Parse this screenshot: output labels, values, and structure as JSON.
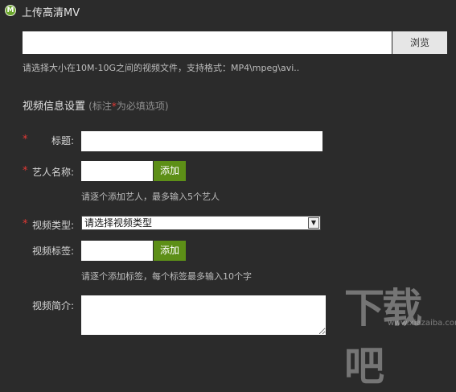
{
  "window": {
    "title": "上传高清MV",
    "logo_letter": "M"
  },
  "upload": {
    "browse_label": "浏览",
    "hint": "请选择大小在10M-10G之间的视频文件，支持格式：MP4\\mpeg\\avi.."
  },
  "section": {
    "title": "视频信息设置",
    "note_prefix": "(标注",
    "note_star": "*",
    "note_suffix": "为必填选项)"
  },
  "form": {
    "required_mark": "*",
    "title_label": "标题:",
    "artist_label": "艺人名称:",
    "artist_add": "添加",
    "artist_hint": "请逐个添加艺人，最多输入5个艺人",
    "type_label": "视频类型:",
    "type_selected": "请选择视频类型",
    "tag_label": "视频标签:",
    "tag_add": "添加",
    "tag_hint": "请逐个添加标签，每个标签最多输入10个字",
    "intro_label": "视频简介:"
  },
  "watermark": {
    "text": "下载吧",
    "sub": "www.xiazaiba.com"
  },
  "colors": {
    "background": "#2b2b2b",
    "accent_green": "#5d8f17",
    "required_red": "#e53935"
  }
}
